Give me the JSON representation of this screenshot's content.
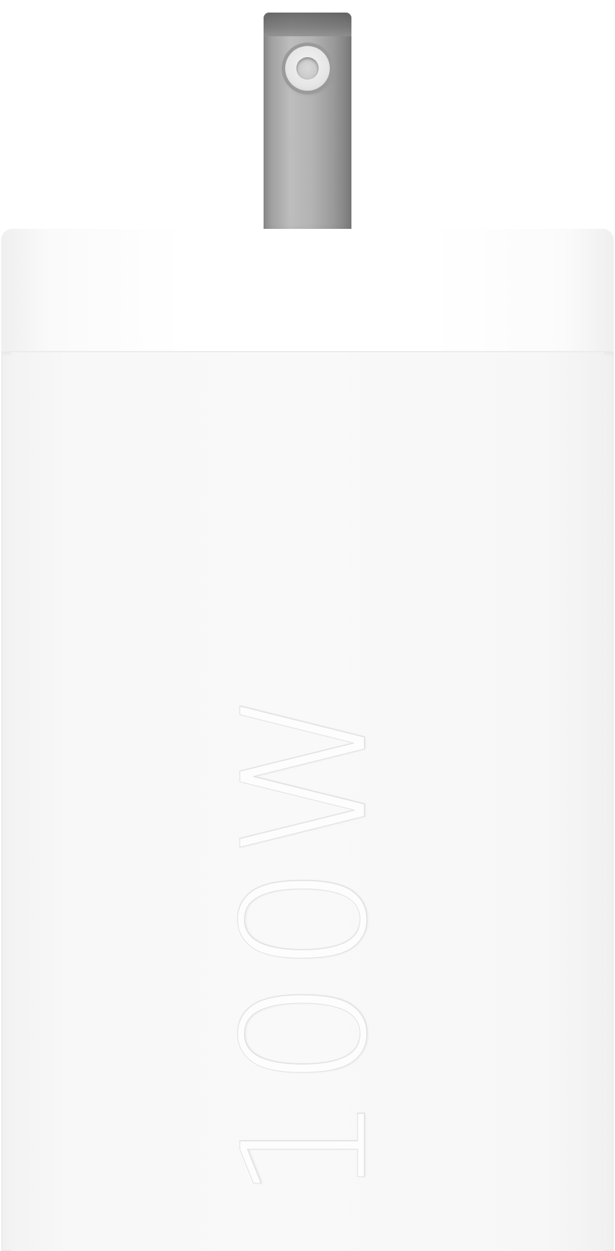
{
  "product": {
    "wattage_marking": "100W"
  },
  "colors": {
    "background": "#ffffff",
    "body": "#f8f8f8",
    "prong": "#a8a8a8"
  }
}
